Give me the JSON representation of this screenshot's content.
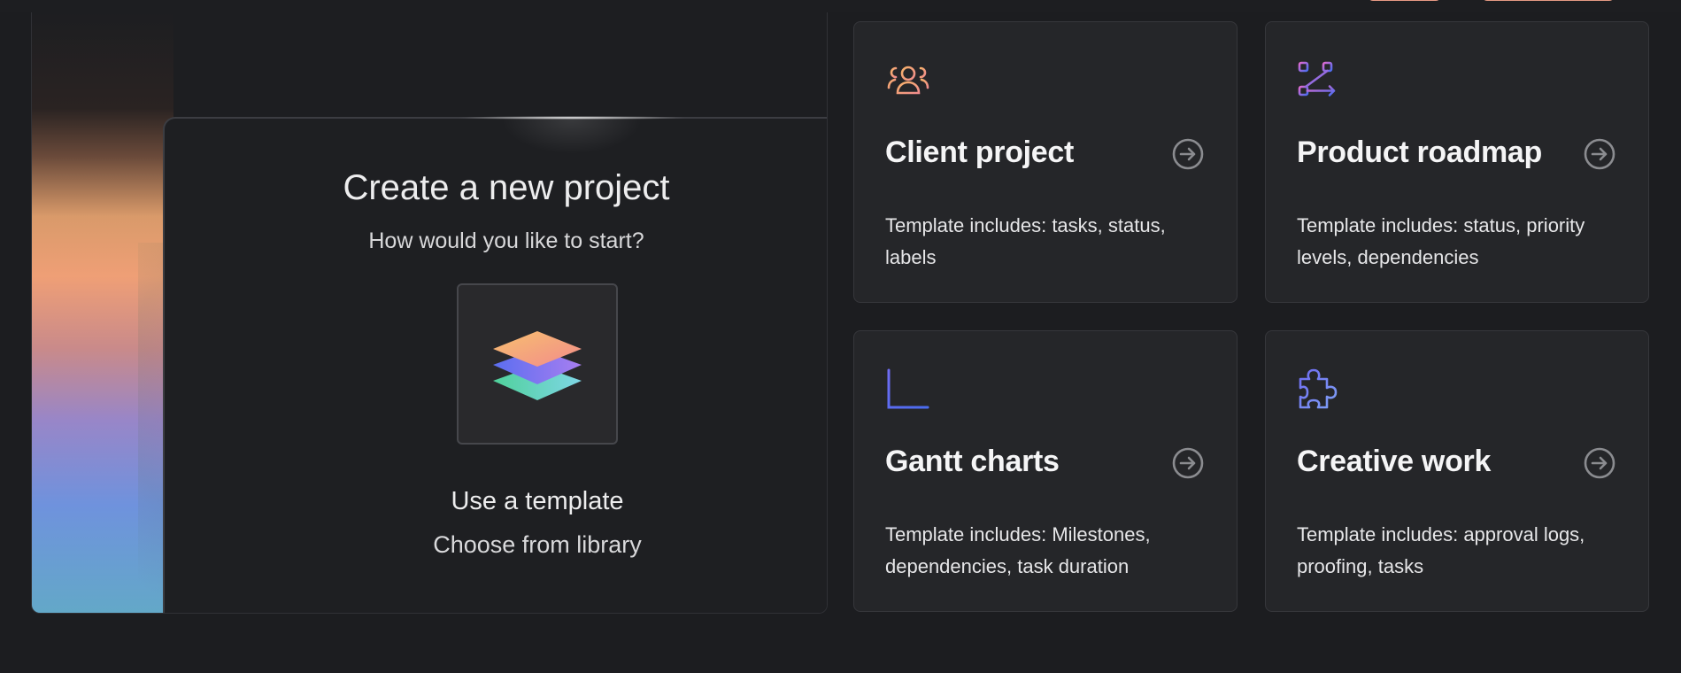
{
  "hero": {
    "title": "Create a new project",
    "subtitle": "How would you like to start?",
    "template_option": {
      "title": "Use a template",
      "subtitle": "Choose from library",
      "icon": "stacked-layers-icon"
    }
  },
  "templates": [
    {
      "title": "Client project",
      "description": "Template includes: tasks, status, labels",
      "icon": "team-users-icon"
    },
    {
      "title": "Product roadmap",
      "description": "Template includes: status, priority levels, dependencies",
      "icon": "roadmap-route-icon"
    },
    {
      "title": "Gantt charts",
      "description": "Template includes: Milestones, dependencies, task duration",
      "icon": "gantt-chart-icon"
    },
    {
      "title": "Creative work",
      "description": "Template includes: approval logs, proofing, tasks",
      "icon": "puzzle-piece-icon"
    }
  ],
  "colors": {
    "background": "#1c1d20",
    "card": "#252629",
    "accent_orange": "#f5a97b",
    "accent_purple": "#6f6cf2",
    "accent_teal": "#5fd3c0",
    "accent_pink": "#d56cc8",
    "accent_blue": "#4a6cf0"
  }
}
